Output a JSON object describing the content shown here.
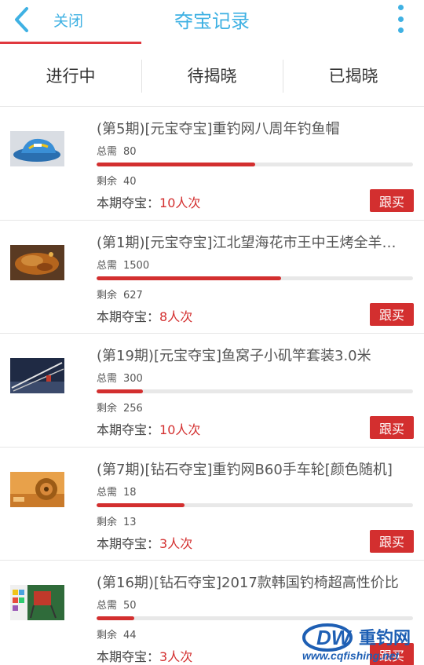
{
  "header": {
    "close_label": "关闭",
    "title": "夺宝记录",
    "accent_color": "#3fb1e3"
  },
  "tabs": [
    {
      "label": "进行中",
      "active": true
    },
    {
      "label": "待揭晓",
      "active": false
    },
    {
      "label": "已揭晓",
      "active": false
    }
  ],
  "labels": {
    "total": "总需",
    "remain": "剩余",
    "current_prefix": "本期夺宝：",
    "times_suffix": "人次",
    "follow": "跟买"
  },
  "items": [
    {
      "title": "(第5期)[元宝夺宝]重钓网八周年钓鱼帽",
      "total": 80,
      "remain": 40,
      "count": 10,
      "thumb_icon": "fishing-hat-image"
    },
    {
      "title": "(第1期)[元宝夺宝]江北望海花市王中王烤全羊…",
      "total": 1500,
      "remain": 627,
      "count": 8,
      "thumb_icon": "roast-lamb-image"
    },
    {
      "title": "(第19期)[元宝夺宝]鱼窝子小矶竿套装3.0米",
      "total": 300,
      "remain": 256,
      "count": 10,
      "thumb_icon": "fishing-rod-image"
    },
    {
      "title": "(第7期)[钻石夺宝]重钓网B60手车轮[颜色随机]",
      "total": 18,
      "remain": 13,
      "count": 3,
      "thumb_icon": "fishing-reel-image"
    },
    {
      "title": "(第16期)[钻石夺宝]2017款韩国钓椅超高性价比",
      "total": 50,
      "remain": 44,
      "count": 3,
      "thumb_icon": "fishing-chair-image"
    }
  ],
  "watermark": {
    "brand": "重钓网",
    "url": "www.cqfishing.net"
  },
  "colors": {
    "progress": "#d32f2f",
    "button": "#d32f2f",
    "tab_underline": "#e0383e"
  }
}
